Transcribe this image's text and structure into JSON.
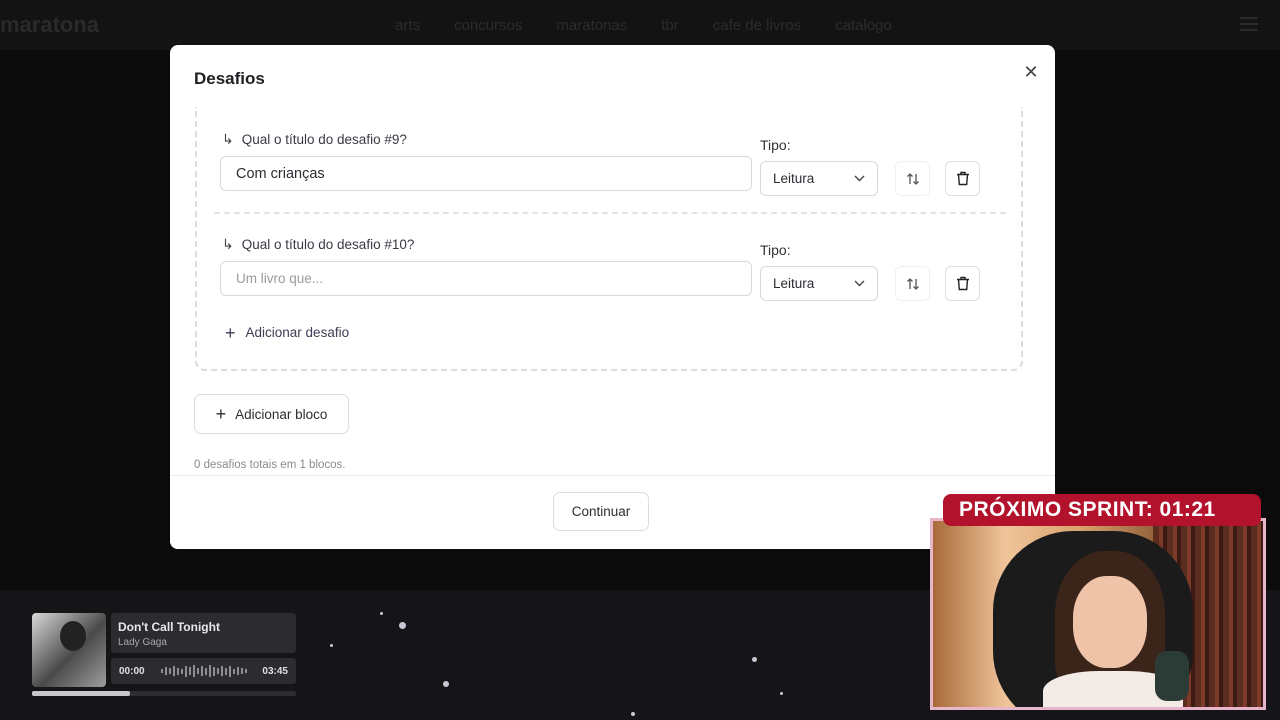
{
  "background": {
    "logo": "maratona",
    "nav_items": [
      "arts",
      "concursos",
      "maratonas",
      "tbr",
      "cafe de livros",
      "catalogo"
    ]
  },
  "modal": {
    "title": "Desafios",
    "challenges": [
      {
        "question": "Qual o título do desafio #9?",
        "value": "Com crianças",
        "placeholder": "Um livro que...",
        "type_label": "Tipo:",
        "type_value": "Leitura"
      },
      {
        "question": "Qual o título do desafio #10?",
        "value": "",
        "placeholder": "Um livro que...",
        "type_label": "Tipo:",
        "type_value": "Leitura"
      }
    ],
    "add_challenge": "Adicionar desafio",
    "add_block": "Adicionar bloco",
    "summary": "0 desafios totais em 1 blocos.",
    "continue": "Continuar"
  },
  "music": {
    "title": "Don't Call Tonight",
    "artist": "Lady Gaga",
    "elapsed": "00:00",
    "duration": "03:45",
    "progress": 0.37
  },
  "overlay": {
    "sprint_label": "PRÓXIMO SPRINT: 01:21"
  }
}
